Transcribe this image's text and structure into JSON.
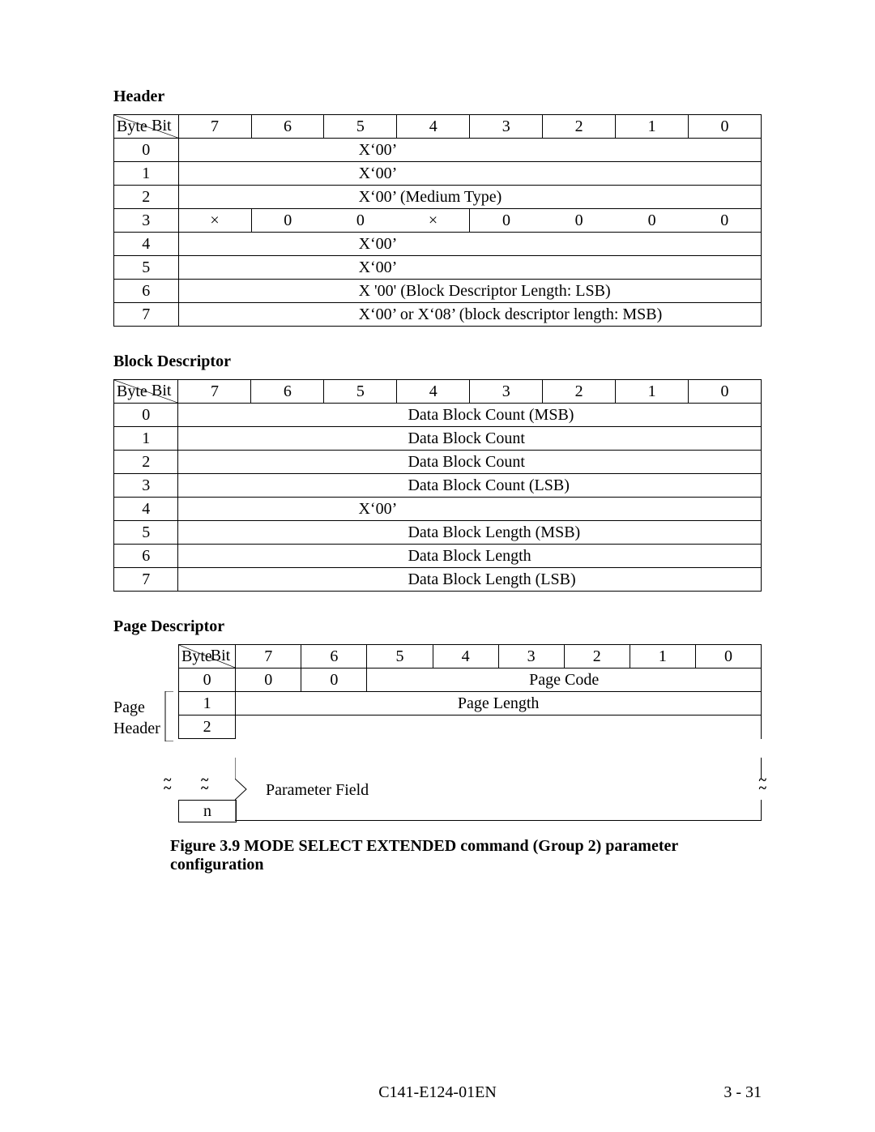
{
  "sections": {
    "header": {
      "title": "Header",
      "bits": [
        "7",
        "6",
        "5",
        "4",
        "3",
        "2",
        "1",
        "0"
      ],
      "bit_label": "Bit",
      "byte_label": "Byte",
      "rows": [
        {
          "byte": "0",
          "type": "full",
          "text": "X‘00’"
        },
        {
          "byte": "1",
          "type": "full",
          "text": "X‘00’"
        },
        {
          "byte": "2",
          "type": "full",
          "text": "X‘00’ (Medium Type)"
        },
        {
          "byte": "3",
          "type": "cells",
          "cells": [
            "×",
            "0",
            "0",
            "×",
            "0",
            "0",
            "0",
            "0"
          ]
        },
        {
          "byte": "4",
          "type": "full",
          "text": "X‘00’"
        },
        {
          "byte": "5",
          "type": "full",
          "text": "X‘00’"
        },
        {
          "byte": "6",
          "type": "full",
          "text": "X '00' (Block Descriptor Length: LSB)"
        },
        {
          "byte": "7",
          "type": "full",
          "text": "X‘00’ or X‘08’ (block descriptor length: MSB)"
        }
      ]
    },
    "block": {
      "title": "Block Descriptor",
      "bits": [
        "7",
        "6",
        "5",
        "4",
        "3",
        "2",
        "1",
        "0"
      ],
      "bit_label": "Bit",
      "byte_label": "Byte",
      "rows": [
        {
          "byte": "0",
          "text": "Data Block Count (MSB)"
        },
        {
          "byte": "1",
          "text": "Data Block Count"
        },
        {
          "byte": "2",
          "text": "Data Block Count"
        },
        {
          "byte": "3",
          "text": "Data Block Count (LSB)"
        },
        {
          "byte": "4",
          "text": "X‘00’"
        },
        {
          "byte": "5",
          "text": "Data Block Length (MSB)"
        },
        {
          "byte": "6",
          "text": "Data Block Length"
        },
        {
          "byte": "7",
          "text": "Data Block Length (LSB)"
        }
      ]
    },
    "page": {
      "title": "Page Descriptor",
      "bits": [
        "7",
        "6",
        "5",
        "4",
        "3",
        "2",
        "1",
        "0"
      ],
      "bit_label": "Bit",
      "byte_label": "Byte",
      "page_header_label": "Page Header",
      "page_header_label_l1": "Page",
      "page_header_label_l2": "Header",
      "row0": {
        "byte": "0",
        "b7": "0",
        "b6": "0",
        "span": "Page Code"
      },
      "row1": {
        "byte": "1",
        "span": "Page Length"
      },
      "param": {
        "start": "2",
        "end": "n",
        "label": "Parameter Field"
      }
    }
  },
  "caption": "Figure 3.9     MODE SELECT EXTENDED command (Group 2) parameter configuration",
  "footer": {
    "doc": "C141-E124-01EN",
    "page": "3 - 31"
  }
}
